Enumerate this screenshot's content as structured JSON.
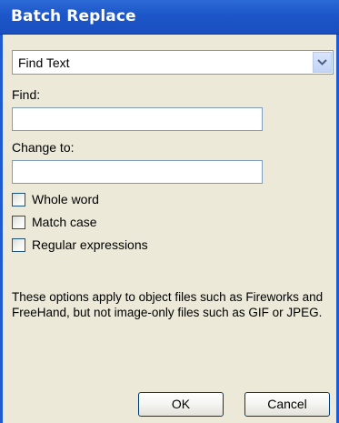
{
  "window": {
    "title": "Batch Replace"
  },
  "mode_select": {
    "value": "Find Text"
  },
  "find": {
    "label": "Find:",
    "value": ""
  },
  "change_to": {
    "label": "Change to:",
    "value": ""
  },
  "options": [
    {
      "label": "Whole word",
      "checked": false
    },
    {
      "label": "Match case",
      "checked": false
    },
    {
      "label": "Regular expressions",
      "checked": false
    }
  ],
  "info_text": "These options apply to object files such as Fireworks and FreeHand, but not image-only files such as GIF or JPEG.",
  "buttons": {
    "ok": "OK",
    "cancel": "Cancel"
  },
  "colors": {
    "titlebar": "#1c56c8",
    "panel_background": "#ece9d8",
    "frame_border": "#1f5bd0",
    "field_border": "#7f9db9",
    "button_border": "#003c74"
  },
  "icons": {
    "dropdown": "chevron-down-icon"
  }
}
